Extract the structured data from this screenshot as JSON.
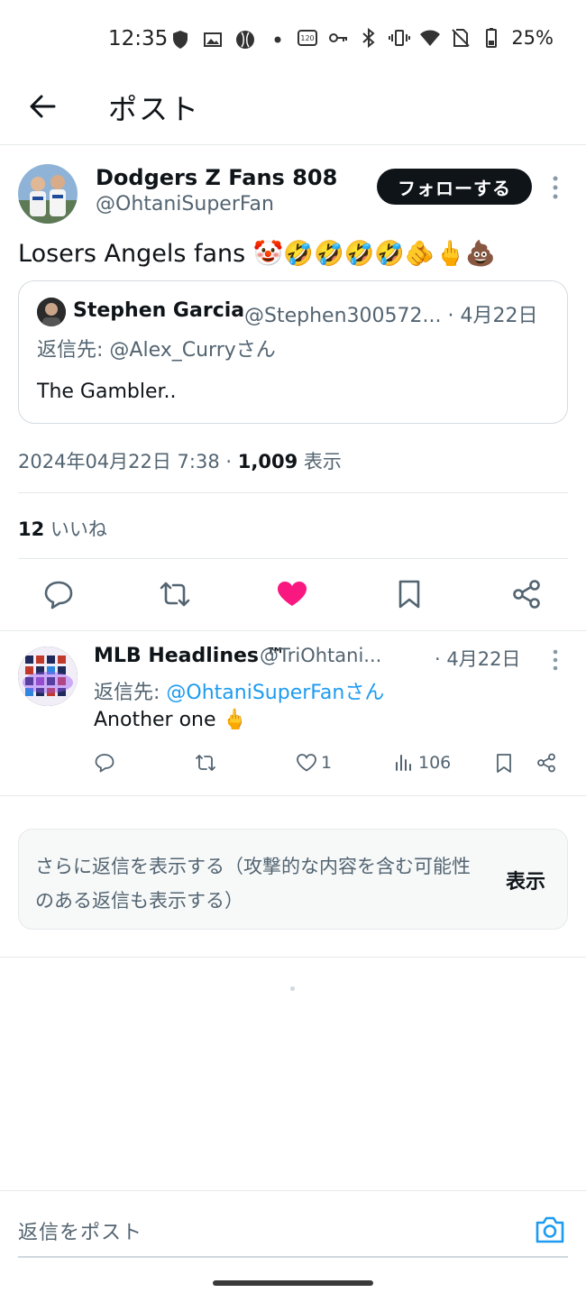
{
  "status_bar": {
    "time": "12:35",
    "battery": "25%",
    "icons": [
      "shield-icon",
      "gallery-icon",
      "baseball-icon",
      "dot-icon",
      "refresh-rate-icon",
      "key-icon",
      "bluetooth-icon",
      "vibrate-icon",
      "wifi-icon",
      "no-sim-icon",
      "battery-icon"
    ]
  },
  "header": {
    "title": "ポスト"
  },
  "post": {
    "author_name": "Dodgers Z Fans 808",
    "author_handle": "@OhtaniSuperFan",
    "follow_label": "フォローする",
    "text": "Losers Angels fans 🤡🤣🤣🤣🤣🫵🖕💩",
    "quote": {
      "name": "Stephen Garcia",
      "handle_date": "@Stephen300572... · 4月22日",
      "reply_to": "返信先: @Alex_Curryさん",
      "text": "The Gambler.."
    },
    "timestamp": "2024年04月22日 7:38 · ",
    "views_count": "1,009",
    "views_label": " 表示",
    "likes_count": "12",
    "likes_label": " いいね",
    "liked": true
  },
  "reply": {
    "name": "MLB Headlines ™",
    "handle": "@TriOhtani...",
    "date": "· 4月22日",
    "reply_to_prefix": "返信先: ",
    "reply_to_handle": "@OhtaniSuperFanさん",
    "text": "Another one 🖕",
    "likes": "1",
    "views": "106"
  },
  "more_replies": {
    "text": "さらに返信を表示する（攻撃的な内容を含む可能性のある返信も表示する）",
    "button": "表示"
  },
  "compose": {
    "placeholder": "返信をポスト"
  },
  "colors": {
    "accent": "#1d9bf0",
    "like": "#f91880",
    "text": "#0f1419",
    "secondary": "#536471"
  }
}
